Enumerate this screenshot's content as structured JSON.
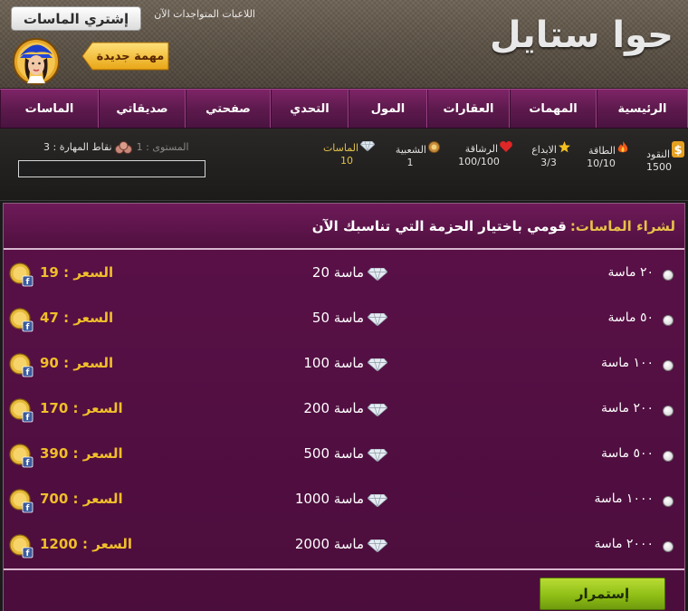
{
  "header": {
    "logo": "حوا ستايل",
    "buy_button": "إشتري الماسات",
    "online_label": "اللاعبات المتواجدات الآن",
    "new_task_button": "مهمة جديدة"
  },
  "nav": {
    "items": [
      {
        "label": "الرئيسية",
        "width": 101
      },
      {
        "label": "المهمات",
        "width": 96
      },
      {
        "label": "العقارات",
        "width": 91
      },
      {
        "label": "المول",
        "width": 87
      },
      {
        "label": "التحدي",
        "width": 86
      },
      {
        "label": "صفحتي",
        "width": 94
      },
      {
        "label": "صديقاتي",
        "width": 96
      },
      {
        "label": "الماسات",
        "width": 109
      }
    ]
  },
  "stats": {
    "money": {
      "label": "النقود",
      "value": "1500"
    },
    "energy": {
      "label": "الطاقة",
      "value": "10/10"
    },
    "creativity": {
      "label": "الابداع",
      "value": "3/3"
    },
    "elegance": {
      "label": "الرشاقة",
      "value": "100/100"
    },
    "popularity": {
      "label": "الشعبية",
      "value": "1"
    },
    "diamonds": {
      "label": "الماسات",
      "value": "10"
    },
    "level_label": "المستوى :",
    "level_value": "1",
    "skill_label": "نقاط المهارة :",
    "skill_value": "3",
    "xp_progress": 0
  },
  "panel": {
    "title_highlight": "لشراء الماسات:",
    "title_rest": "قومي باختيار الحزمة التي تناسبك الآن",
    "packages": [
      {
        "option": "٢٠ ماسة",
        "amount": "ماسة 20",
        "price": "السعر : 19"
      },
      {
        "option": "٥٠ ماسة",
        "amount": "ماسة 50",
        "price": "السعر : 47"
      },
      {
        "option": "١٠٠ ماسة",
        "amount": "ماسة 100",
        "price": "السعر : 90"
      },
      {
        "option": "٢٠٠ ماسة",
        "amount": "ماسة 200",
        "price": "السعر : 170"
      },
      {
        "option": "٥٠٠ ماسة",
        "amount": "ماسة 500",
        "price": "السعر : 390"
      },
      {
        "option": "١٠٠٠ ماسة",
        "amount": "ماسة 1000",
        "price": "السعر : 700"
      },
      {
        "option": "٢٠٠٠ ماسة",
        "amount": "ماسة 2000",
        "price": "السعر : 1200"
      }
    ],
    "continue_button": "إستمرار"
  },
  "colors": {
    "accent_gold": "#f0be2a",
    "nav_purple": "#5e1a4d",
    "panel_purple": "#4b0d3c",
    "button_green": "#8fbf16"
  }
}
